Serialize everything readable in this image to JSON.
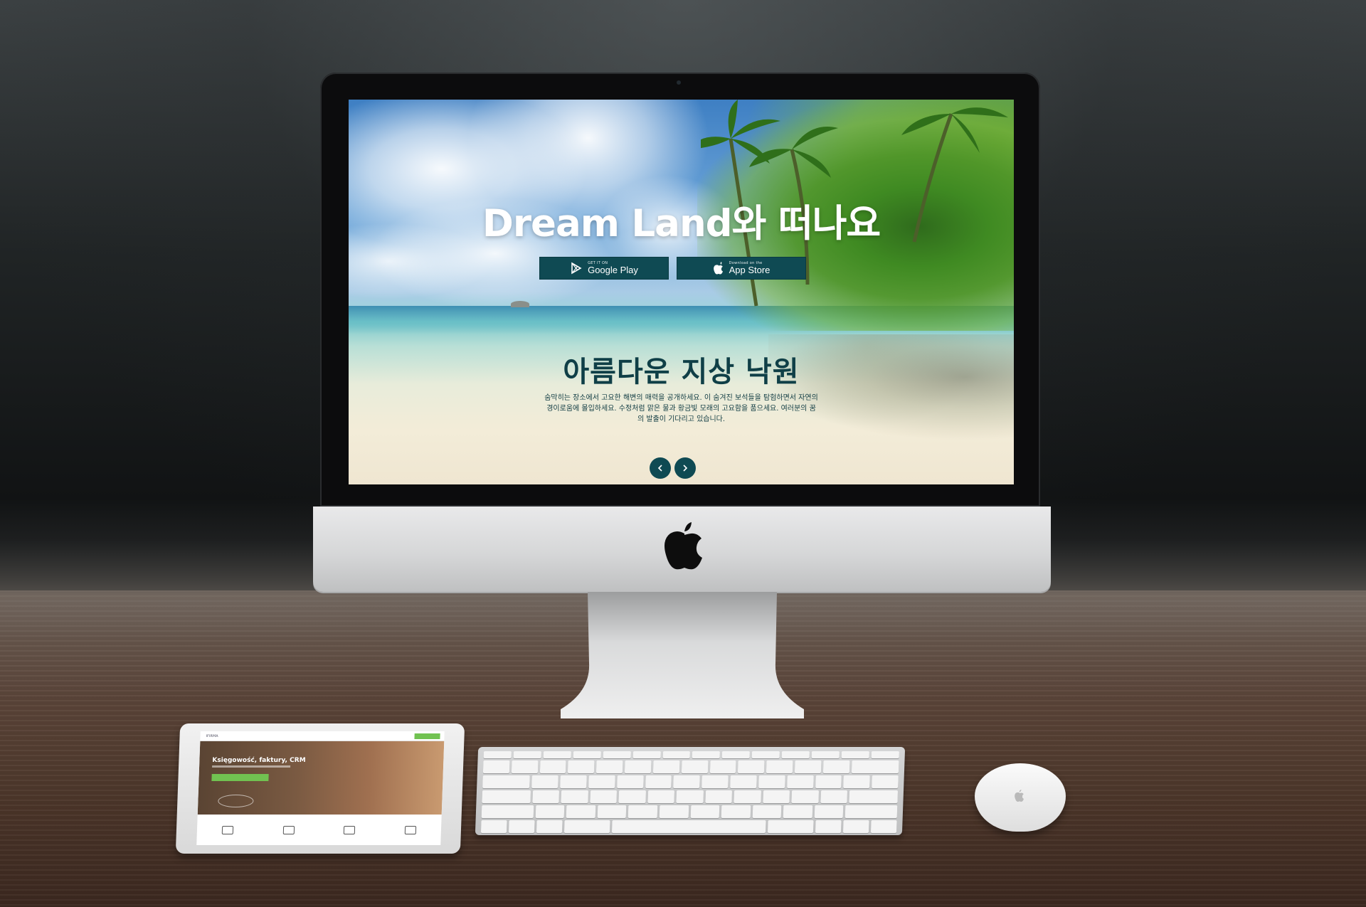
{
  "hero": {
    "title": "Dream Land와 떠나요"
  },
  "store_buttons": {
    "google_small": "GET IT ON",
    "google_label": "Google Play",
    "apple_small": "Download on the",
    "apple_label": "App Store"
  },
  "section": {
    "title": "아름다운 지상 낙원",
    "body": "숨막히는 장소에서 고요한 해변의 매력을 공개하세요. 이 숨겨진 보석들을 탐험하면서 자연의 경이로움에 몰입하세요. 수정처럼 맑은 물과 황금빛 모래의 고요함을 품으세요. 여러분의 꿈의 발출이 기다리고 있습니다."
  },
  "slider": {
    "prev_icon": "chevron-left-icon",
    "next_icon": "chevron-right-icon"
  },
  "ipad_site": {
    "hero_title": "Księgowość, faktury, CRM",
    "logo": "IFIRMA"
  },
  "colors": {
    "brand_dark_teal": "#0f4a53",
    "heading_teal": "#0f3f47",
    "hero_text": "#ffffff",
    "ipad_accent_green": "#71c251"
  }
}
